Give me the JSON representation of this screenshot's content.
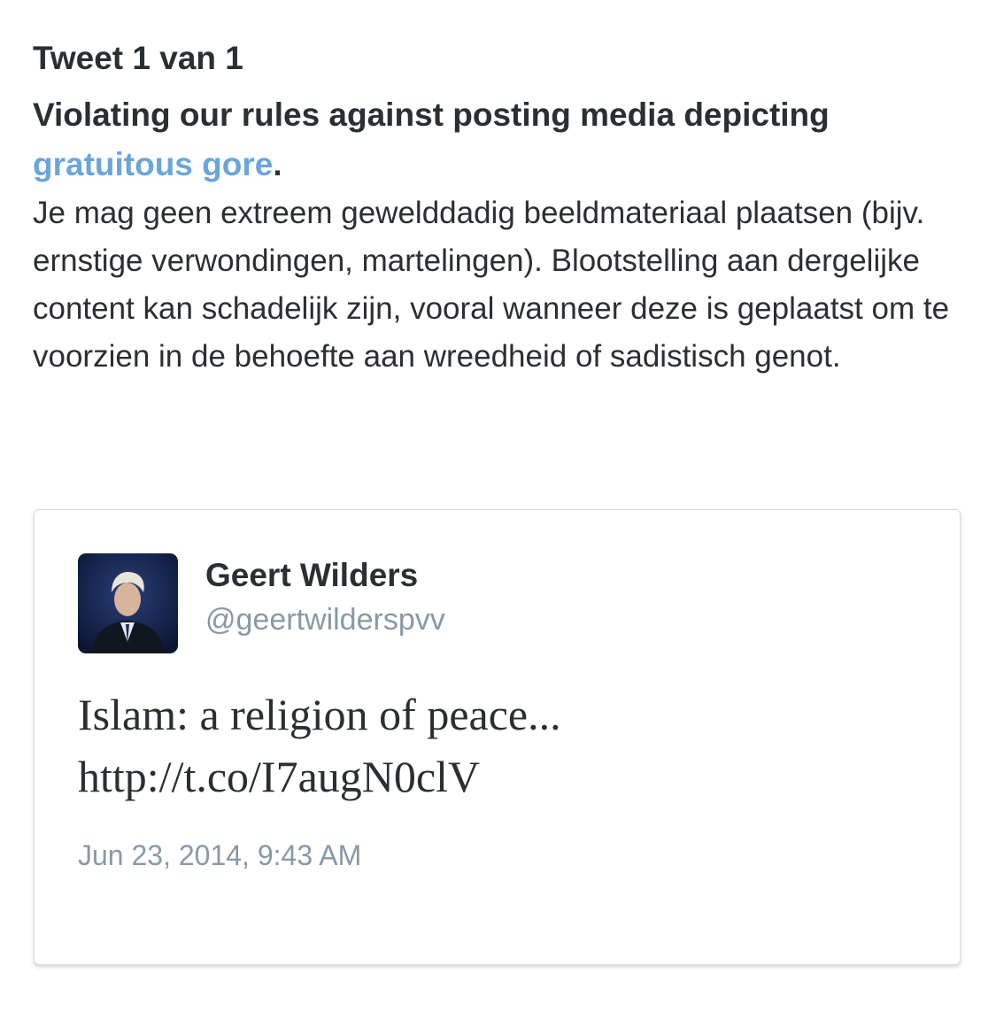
{
  "notice": {
    "counter": "Tweet 1 van 1",
    "rule_prefix": "Violating our rules against posting media depicting",
    "rule_link": "gratuitous gore",
    "rule_suffix": ".",
    "description": "Je mag geen extreem gewelddadig beeldmateriaal plaatsen (bijv. ernstige verwondingen, martelingen). Blootstelling aan dergelijke content kan schadelijk zijn, vooral wanneer deze is geplaatst om te voorzien in de behoefte aan wreedheid of sadistisch genot."
  },
  "tweet": {
    "author_name": "Geert Wilders",
    "handle": "@geertwilderspvv",
    "text_line1": "Islam: a religion of peace...",
    "text_line2": "http://t.co/I7augN0clV",
    "timestamp": "Jun 23, 2014, 9:43 AM"
  },
  "colors": {
    "link": "#6aa5dc",
    "text": "#292f33",
    "muted": "#8899a6"
  }
}
